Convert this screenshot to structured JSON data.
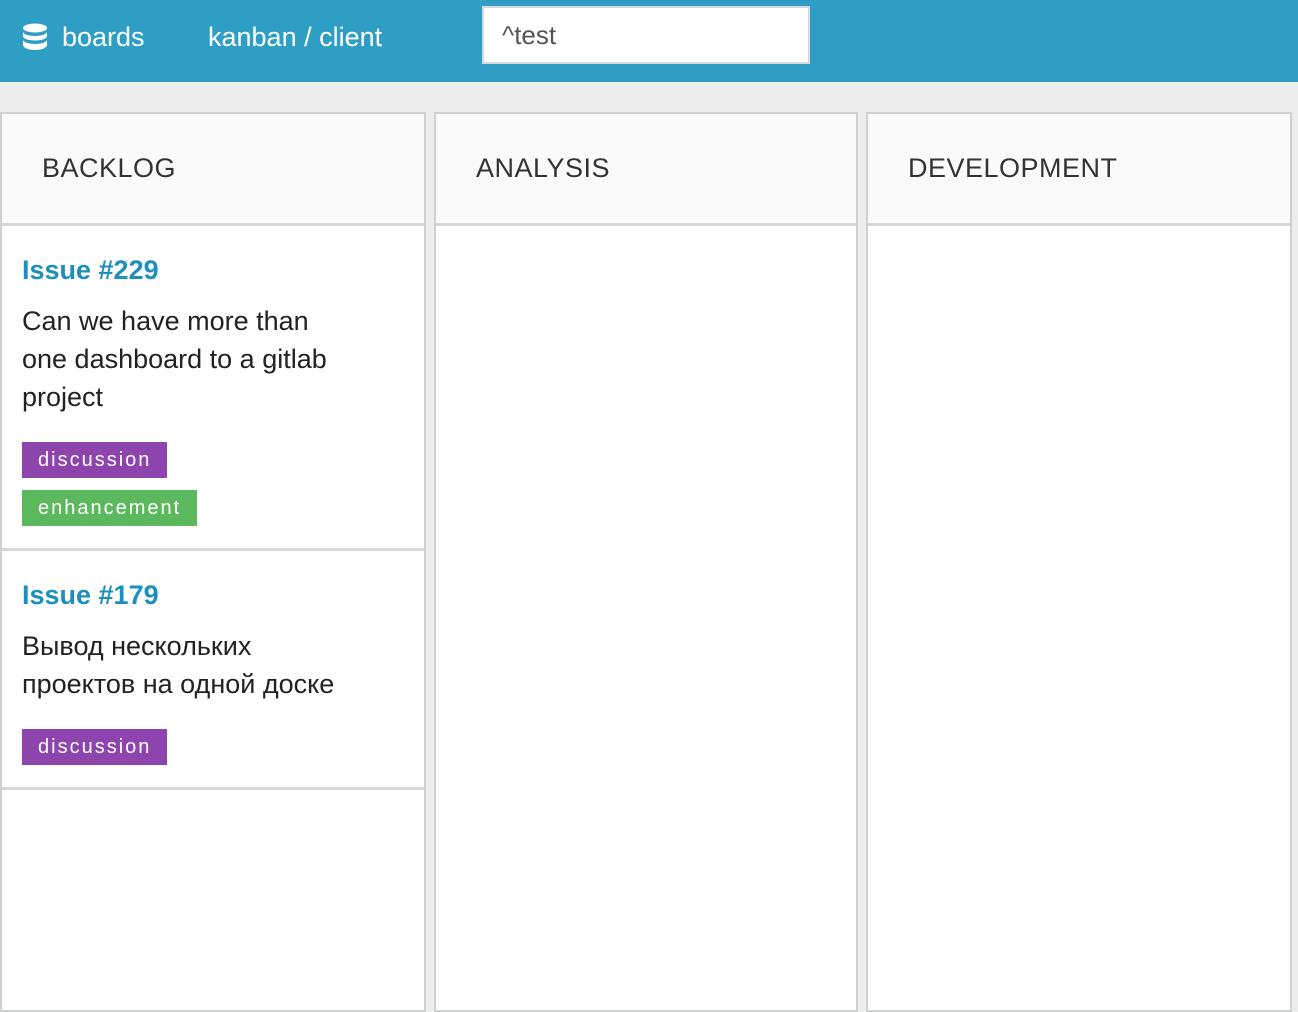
{
  "header": {
    "brand_label": "boards",
    "brand_icon": "database-icon",
    "breadcrumb": "kanban / client",
    "search_value": "^test"
  },
  "colors": {
    "topbar": "#2e9ec4",
    "issue_link": "#1d8fbd",
    "label_discussion": "#8e44ad",
    "label_enhancement": "#5cb85c"
  },
  "columns": [
    {
      "title": "BACKLOG",
      "cards": [
        {
          "title": "Issue #229",
          "description": "Can we have more than one dashboard to a gitlab project",
          "labels": [
            "discussion",
            "enhancement"
          ]
        },
        {
          "title": "Issue #179",
          "description": "Вывод нескольких проектов на одной доске",
          "labels": [
            "discussion"
          ]
        }
      ]
    },
    {
      "title": "ANALYSIS",
      "cards": []
    },
    {
      "title": "DEVELOPMENT",
      "cards": []
    }
  ]
}
